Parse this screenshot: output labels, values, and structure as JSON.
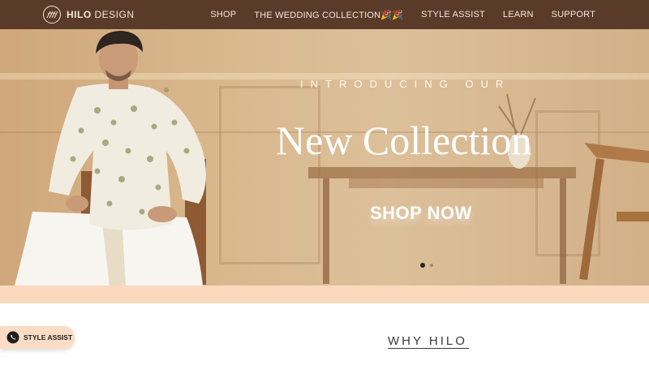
{
  "brand": {
    "name_bold": "HILO",
    "name_rest": " DESIGN",
    "logo_icon": "hilo-monogram-icon"
  },
  "nav": {
    "items": [
      {
        "label": "SHOP"
      },
      {
        "label": "THE WEDDING COLLECTION🎉🎉"
      },
      {
        "label": "STYLE ASSIST"
      },
      {
        "label": "LEARN"
      },
      {
        "label": "SUPPORT"
      }
    ]
  },
  "hero": {
    "subtitle": "INTRODUCING OUR",
    "title": "New Collection",
    "cta": "SHOP NOW",
    "slide_count": 2,
    "active_slide": 1
  },
  "section": {
    "heading": "WHY HILO"
  },
  "floating": {
    "style_assist_label": "STYLE ASSIST",
    "icon": "whatsapp-icon"
  },
  "colors": {
    "header_bg": "#5a3b2a",
    "header_text": "#f3e6d8",
    "band": "#fbd9bd",
    "button_bg": "#fcdcc4"
  }
}
